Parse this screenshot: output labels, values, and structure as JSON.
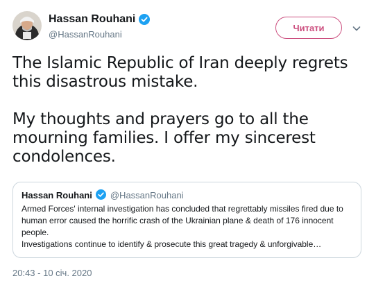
{
  "author": {
    "name": "Hassan Rouhani",
    "handle": "@HassanRouhani",
    "verified": true
  },
  "follow_button": {
    "label": "Читати"
  },
  "tweet": {
    "paragraphs": [
      "The Islamic Republic of Iran deeply regrets this disastrous mistake.",
      "My thoughts and prayers go to all the mourning families. I offer my sincerest condolences."
    ]
  },
  "quoted_tweet": {
    "name": "Hassan Rouhani",
    "handle": "@HassanRouhani",
    "verified": true,
    "lines": [
      "Armed Forces' internal investigation has concluded that regrettably missiles fired due to human error caused the horrific crash of the Ukrainian plane & death of 176 innocent people.",
      "Investigations continue to identify & prosecute this great tragedy & unforgivable…"
    ]
  },
  "timestamp": "20:43 - 10 січ. 2020",
  "colors": {
    "accent": "#cc4f7f",
    "verified": "#1da1f2",
    "muted": "#657786",
    "text": "#14171a",
    "border": "#ccd6dd"
  },
  "icons": {
    "verified": "verified-badge-icon",
    "caret": "chevron-down-icon"
  }
}
